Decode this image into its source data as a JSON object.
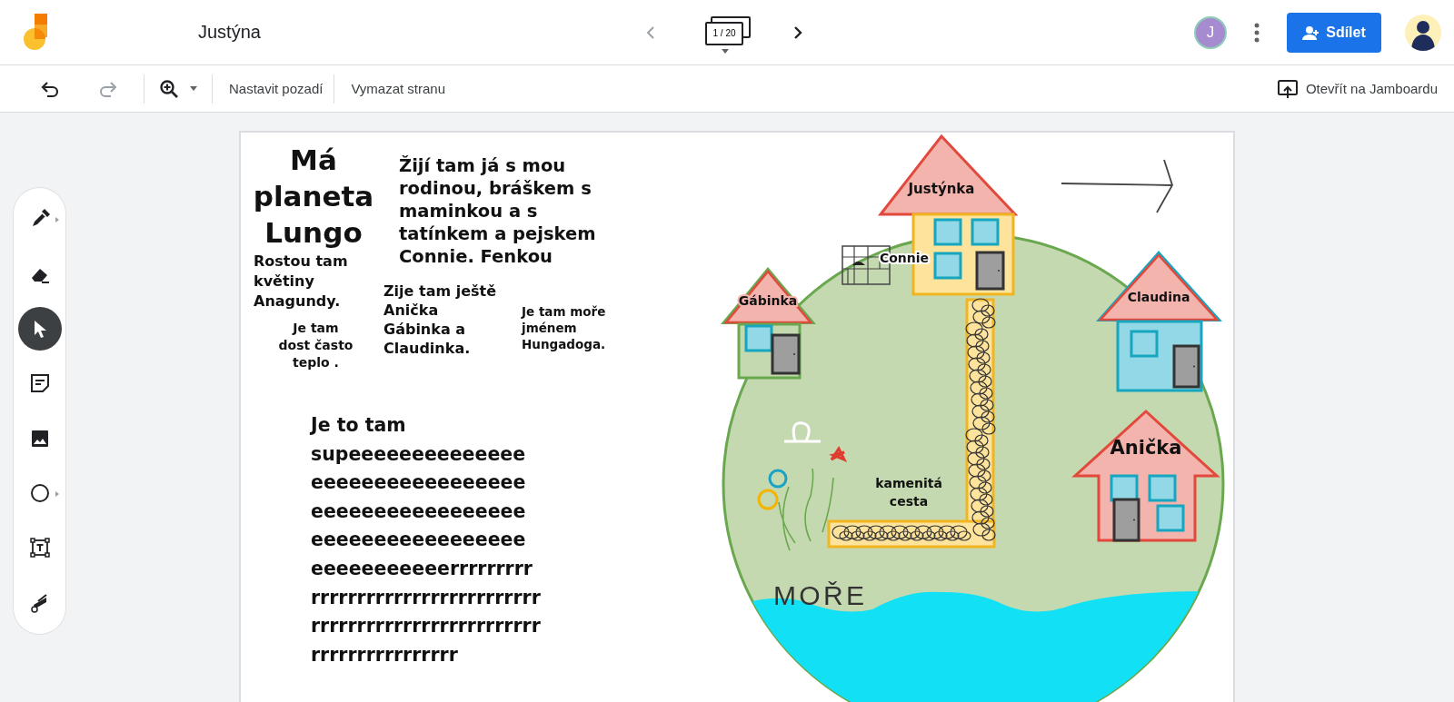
{
  "topbar": {
    "document_title": "Justýna",
    "page_indicator": "1 / 20",
    "user_initial": "J",
    "share_button": "Sdílet"
  },
  "toolbar": {
    "actions": [
      "Nastavit pozadí",
      "Vymazat stranu"
    ],
    "open_button": "Otevřít na Jamboardu"
  },
  "tools": [
    {
      "kind": "pen",
      "selected": false
    },
    {
      "kind": "eraser",
      "selected": false
    },
    {
      "kind": "select",
      "selected": true
    },
    {
      "kind": "sticky_note",
      "selected": false
    },
    {
      "kind": "image",
      "selected": false
    },
    {
      "kind": "shape",
      "selected": false
    },
    {
      "kind": "text_box",
      "selected": false
    },
    {
      "kind": "laser",
      "selected": false
    }
  ],
  "canvas": {
    "texts": [
      {
        "lines": [
          "Má",
          "planeta",
          "Lungo"
        ]
      },
      {
        "lines": [
          "Rostou tam",
          "květiny",
          "Anagundy."
        ]
      },
      {
        "lines": [
          "Je tam",
          "dost často",
          "teplo ."
        ]
      },
      {
        "lines": [
          "Žijí tam já s mou",
          "rodinou, bráškem s",
          "maminkou a s",
          "tatínkem a pejskem",
          "Connie. Fenkou"
        ]
      },
      {
        "lines": [
          "Zije tam ještě",
          "Anička",
          "Gábinka a",
          "Claudinka."
        ]
      },
      {
        "lines": [
          "Je tam moře",
          "jménem",
          "Hungadoga."
        ]
      },
      {
        "lines": [
          "Je to tam",
          "supeeeeeeeeeeeeee",
          "eeeeeeeeeeeeeeeee",
          "eeeeeeeeeeeeeeeee",
          "eeeeeeeeeeeeeeeee",
          "eeeeeeeeeeerrrrrrrrr",
          "rrrrrrrrrrrrrrrrrrrrrrrrr",
          "rrrrrrrrrrrrrrrrrrrrrrrrr",
          "rrrrrrrrrrrrrrrr"
        ]
      }
    ],
    "labels": [
      {
        "lines": [
          "Justýnka"
        ]
      },
      {
        "lines": [
          "Connie"
        ]
      },
      {
        "lines": [
          "Gábinka"
        ]
      },
      {
        "lines": [
          "Claudina"
        ]
      },
      {
        "lines": [
          "Anička"
        ]
      },
      {
        "lines": [
          "kamenitá",
          "cesta"
        ]
      },
      {
        "lines": [
          "MOŘE"
        ]
      }
    ]
  }
}
